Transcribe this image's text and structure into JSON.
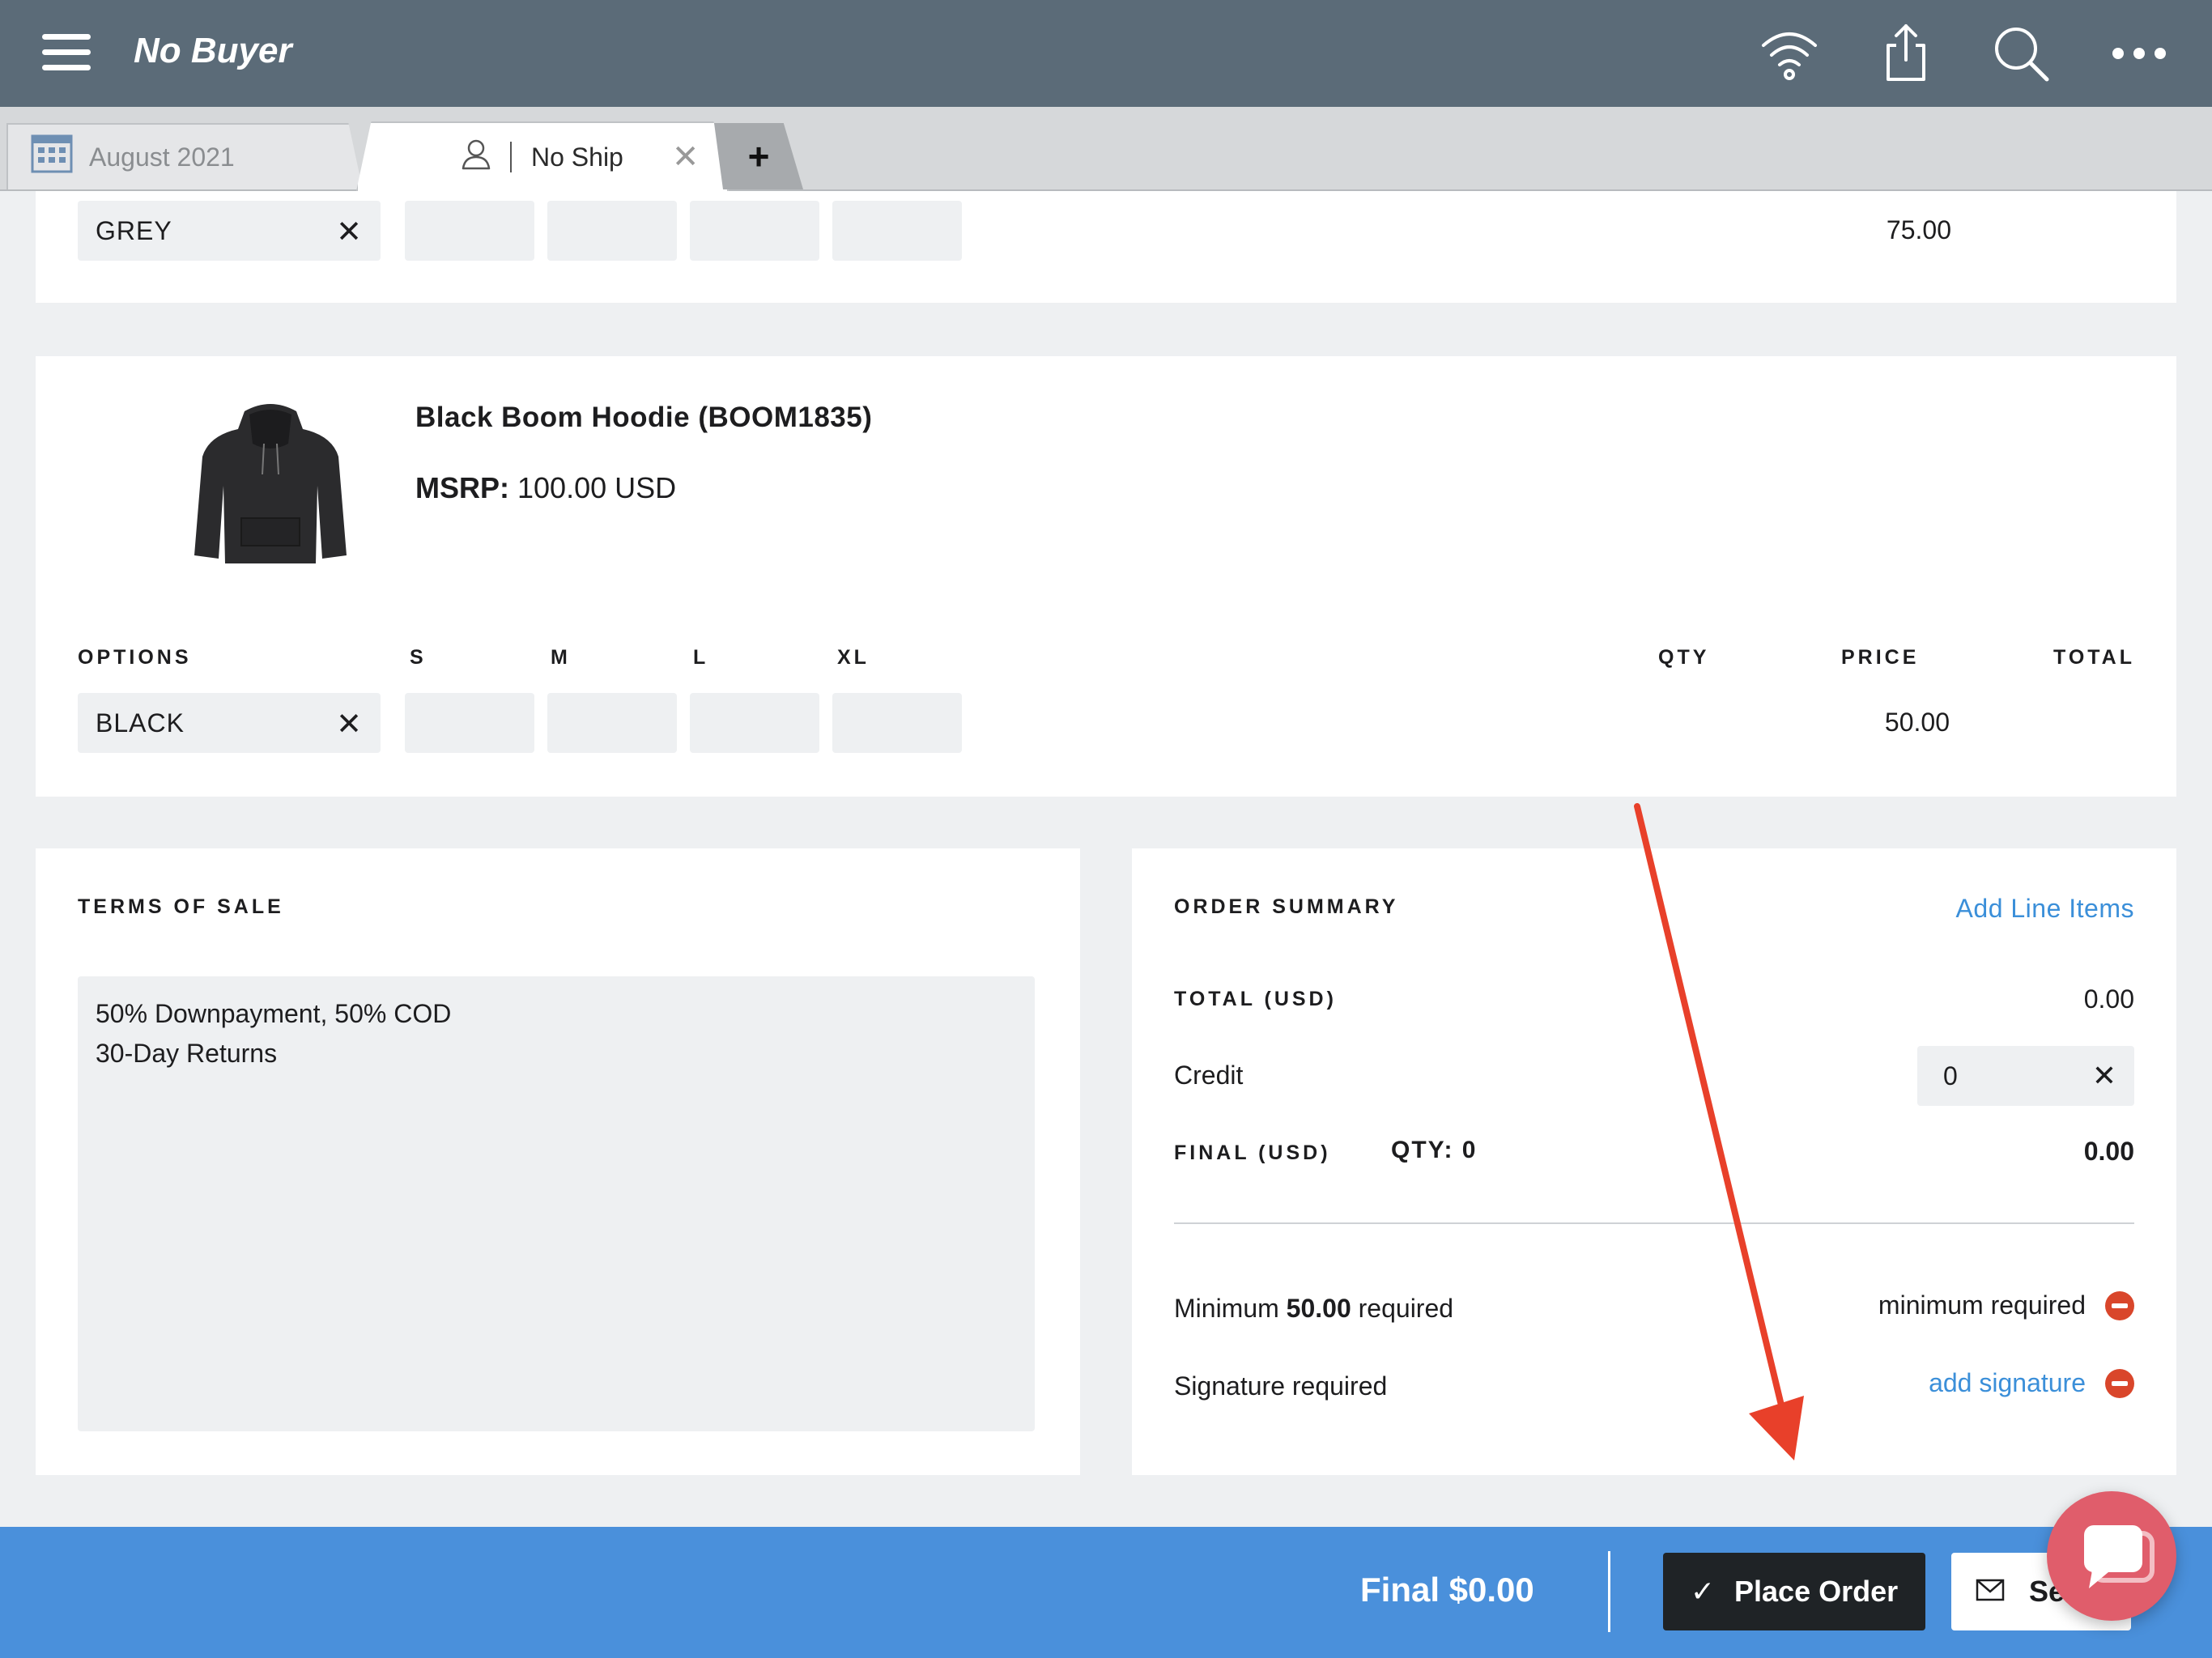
{
  "header": {
    "title": "No Buyer",
    "icons": [
      "menu-icon",
      "wifi-icon",
      "share-icon",
      "search-icon",
      "more-icon"
    ]
  },
  "tabs": {
    "calendar_tab": "August 2021",
    "ship_tab": "No Ship",
    "add_tab": "+"
  },
  "product_prev": {
    "option": "GREY",
    "price": "75.00"
  },
  "product": {
    "name": "Black Boom Hoodie (BOOM1835)",
    "msrp_label": "MSRP:",
    "msrp_value": "100.00 USD",
    "columns": {
      "options": "OPTIONS",
      "sizes": [
        "S",
        "M",
        "L",
        "XL"
      ],
      "qty": "QTY",
      "price": "PRICE",
      "total": "TOTAL"
    },
    "option": "BLACK",
    "price": "50.00"
  },
  "terms": {
    "title": "TERMS OF SALE",
    "line1": "50% Downpayment, 50% COD",
    "line2": "30-Day Returns"
  },
  "summary": {
    "title": "ORDER SUMMARY",
    "add_line_items": "Add Line Items",
    "total_label": "TOTAL (USD)",
    "total_value": "0.00",
    "credit_label": "Credit",
    "credit_value": "0",
    "final_label": "FINAL (USD)",
    "qty_label": "QTY: 0",
    "final_value": "0.00",
    "minimum_prefix": "Minimum",
    "minimum_amount": "50.00",
    "minimum_suffix": "required",
    "minimum_status": "minimum required",
    "signature_label": "Signature required",
    "signature_action": "add signature"
  },
  "footer": {
    "final": "Final $0.00",
    "place_order": "Place Order",
    "send": "Se"
  },
  "colors": {
    "topbar": "#5b6b78",
    "accent_blue": "#4a90db",
    "link_blue": "#3b8fd9",
    "error_red": "#d9462b",
    "annotation_arrow": "#e8402a"
  }
}
